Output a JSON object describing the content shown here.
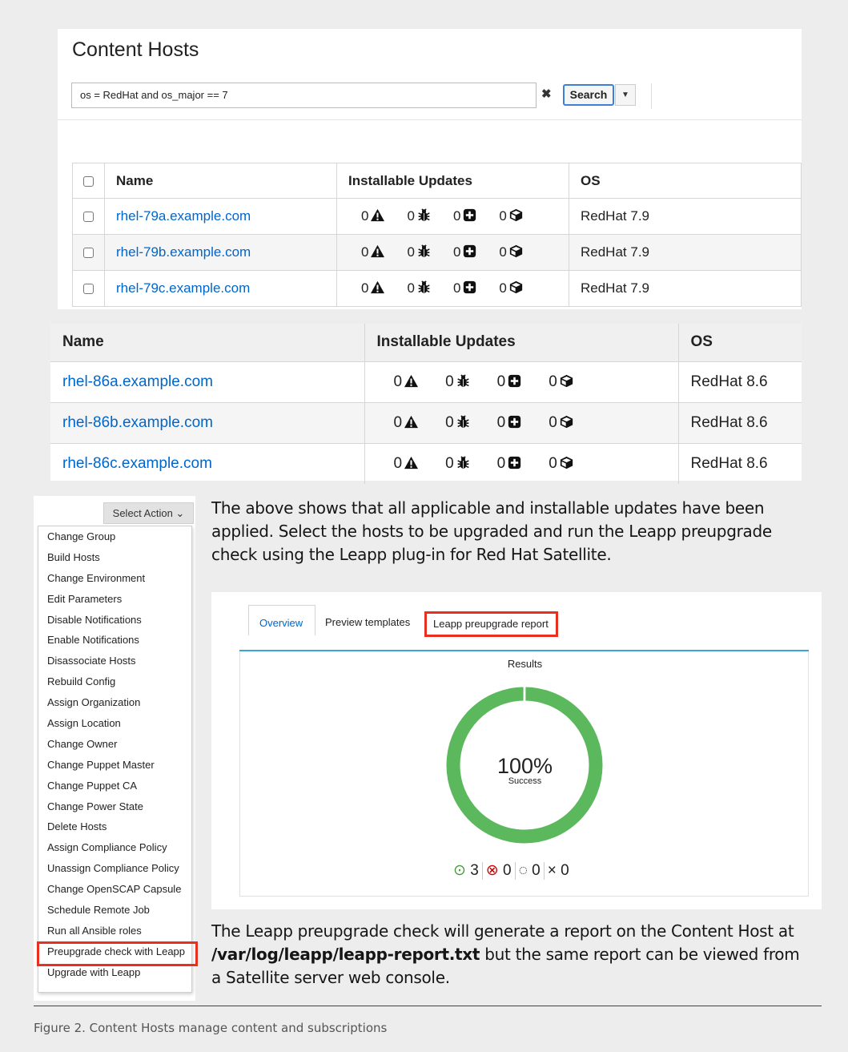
{
  "content_hosts": {
    "title": "Content Hosts",
    "search_value": "os = RedHat and  os_major == 7",
    "clear_glyph": "✖",
    "search_button": "Search",
    "caret": "▼",
    "columns": [
      "Name",
      "Installable Updates",
      "OS"
    ],
    "rows": [
      {
        "name": "rhel-79a.example.com",
        "security": "0",
        "bugfix": "0",
        "enhancement": "0",
        "packages": "0",
        "os": "RedHat 7.9"
      },
      {
        "name": "rhel-79b.example.com",
        "security": "0",
        "bugfix": "0",
        "enhancement": "0",
        "packages": "0",
        "os": "RedHat 7.9"
      },
      {
        "name": "rhel-79c.example.com",
        "security": "0",
        "bugfix": "0",
        "enhancement": "0",
        "packages": "0",
        "os": "RedHat 7.9"
      }
    ]
  },
  "rhel86_table": {
    "columns": [
      "Name",
      "Installable Updates",
      "OS"
    ],
    "rows": [
      {
        "name": "rhel-86a.example.com",
        "security": "0",
        "bugfix": "0",
        "enhancement": "0",
        "packages": "0",
        "os": "RedHat 8.6"
      },
      {
        "name": "rhel-86b.example.com",
        "security": "0",
        "bugfix": "0",
        "enhancement": "0",
        "packages": "0",
        "os": "RedHat 8.6"
      },
      {
        "name": "rhel-86c.example.com",
        "security": "0",
        "bugfix": "0",
        "enhancement": "0",
        "packages": "0",
        "os": "RedHat 8.6"
      }
    ]
  },
  "select_action": {
    "label": "Select Action ⌄",
    "items": [
      "Change Group",
      "Build Hosts",
      "Change Environment",
      "Edit Parameters",
      "Disable Notifications",
      "Enable Notifications",
      "Disassociate Hosts",
      "Rebuild Config",
      "Assign Organization",
      "Assign Location",
      "Change Owner",
      "Change Puppet Master",
      "Change Puppet CA",
      "Change Power State",
      "Delete Hosts",
      "Assign Compliance Policy",
      "Unassign Compliance Policy",
      "Change OpenSCAP Capsule",
      "Schedule Remote Job",
      "Run all Ansible roles",
      "Preupgrade check with Leapp",
      "Upgrade with Leapp"
    ],
    "highlighted_item": "Preupgrade check with Leapp"
  },
  "paragraph_1": "The above shows that all applicable and installable updates have been applied. Select the hosts to be upgraded and run the Leapp preupgrade check using the Leapp plug-in for Red Hat Satellite.",
  "report": {
    "tabs": [
      "Overview",
      "Preview templates",
      "Leapp preupgrade report"
    ],
    "results_title": "Results",
    "percent": "100%",
    "percent_label": "Success",
    "success_fraction": 1.0,
    "stats": {
      "success": "3",
      "failed": "0",
      "pending": "0",
      "cancelled": "0"
    },
    "stat_icons": {
      "success": "⊙",
      "failed": "⊗",
      "pending": "◌",
      "cancelled": "×"
    },
    "colors": {
      "success": "#5cb85c",
      "failed": "#cc0000",
      "tab_active": "#0066cc",
      "highlight": "#e8301e"
    }
  },
  "paragraph_2": {
    "before": "The Leapp preupgrade check will generate a report on the Content Host at ",
    "path": "/var/log/leapp/leapp-report.txt",
    "after": " but the same report can be viewed from a Satellite server web console."
  },
  "caption": "Figure 2. Content Hosts manage content and subscriptions",
  "icons": {
    "security": "warning-triangle-icon",
    "bugfix": "bug-icon",
    "enhancement": "plus-square-icon",
    "packages": "package-icon"
  }
}
